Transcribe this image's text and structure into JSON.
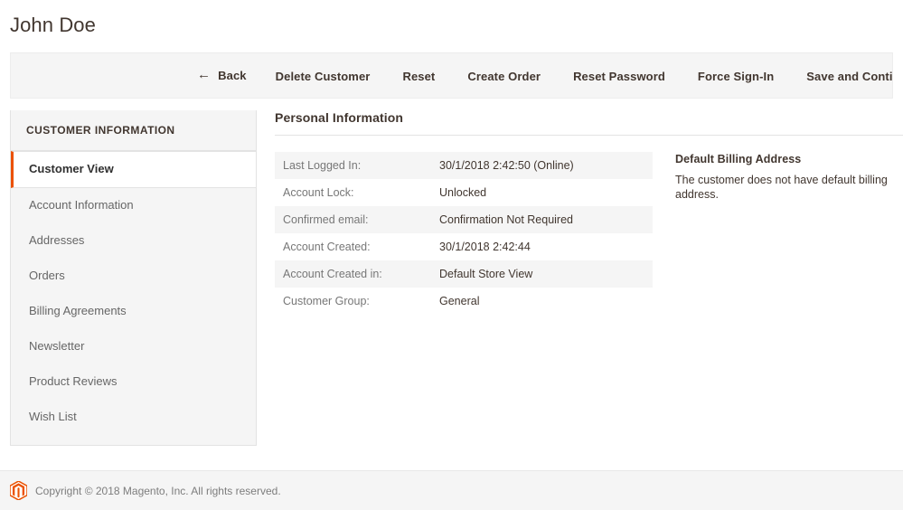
{
  "page": {
    "title": "John Doe"
  },
  "toolbar": {
    "buttons": [
      {
        "label": "Back",
        "icon": "arrow-left-icon"
      },
      {
        "label": "Delete Customer"
      },
      {
        "label": "Reset"
      },
      {
        "label": "Create Order"
      },
      {
        "label": "Reset Password"
      },
      {
        "label": "Force Sign-In"
      },
      {
        "label": "Save and Continue"
      }
    ]
  },
  "sidebar": {
    "title": "CUSTOMER INFORMATION",
    "items": [
      {
        "label": "Customer View",
        "active": true
      },
      {
        "label": "Account Information",
        "active": false
      },
      {
        "label": "Addresses",
        "active": false
      },
      {
        "label": "Orders",
        "active": false
      },
      {
        "label": "Billing Agreements",
        "active": false
      },
      {
        "label": "Newsletter",
        "active": false
      },
      {
        "label": "Product Reviews",
        "active": false
      },
      {
        "label": "Wish List",
        "active": false
      }
    ]
  },
  "main": {
    "section_title": "Personal Information",
    "personal_information": [
      {
        "label": "Last Logged In:",
        "value": "30/1/2018 2:42:50 (Online)"
      },
      {
        "label": "Account Lock:",
        "value": "Unlocked"
      },
      {
        "label": "Confirmed email:",
        "value": "Confirmation Not Required"
      },
      {
        "label": "Account Created:",
        "value": "30/1/2018 2:42:44"
      },
      {
        "label": "Account Created in:",
        "value": "Default Store View"
      },
      {
        "label": "Customer Group:",
        "value": "General"
      }
    ],
    "billing": {
      "title": "Default Billing Address",
      "text": "The customer does not have default billing address."
    }
  },
  "footer": {
    "logo": "magento-logo-icon",
    "copyright": "Copyright © 2018 Magento, Inc. All rights reserved."
  },
  "colors": {
    "accent": "#eb5202",
    "toolbar_bg": "#f5f5f5",
    "sidebar_bg": "#f5f5f5",
    "row_alt_bg": "#f5f5f5",
    "text": "#41362f",
    "muted_text": "#777777"
  }
}
